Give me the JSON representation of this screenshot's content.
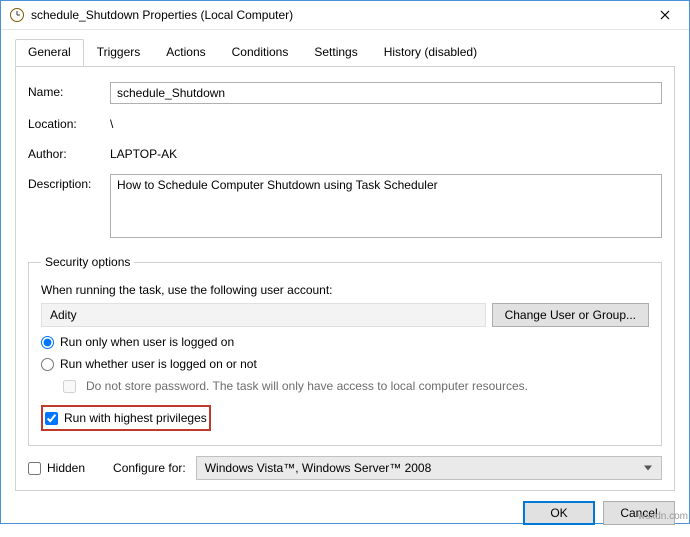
{
  "window": {
    "title": "schedule_Shutdown Properties (Local Computer)"
  },
  "tabs": {
    "general": "General",
    "triggers": "Triggers",
    "actions": "Actions",
    "conditions": "Conditions",
    "settings": "Settings",
    "history": "History (disabled)"
  },
  "labels": {
    "name": "Name:",
    "location": "Location:",
    "author": "Author:",
    "description": "Description:"
  },
  "values": {
    "name": "schedule_Shutdown",
    "location": "\\",
    "author": "LAPTOP-AK",
    "description": "How to Schedule Computer Shutdown using Task Scheduler"
  },
  "security": {
    "legend": "Security options",
    "prompt": "When running the task, use the following user account:",
    "user": "Adity",
    "change_user": "Change User or Group...",
    "run_logged_on": "Run only when user is logged on",
    "run_whether": "Run whether user is logged on or not",
    "do_not_store": "Do not store password.  The task will only have access to local computer resources.",
    "highest_priv": "Run with highest privileges"
  },
  "footer": {
    "hidden": "Hidden",
    "configure_for": "Configure for:",
    "configure_value": "Windows Vista™, Windows Server™ 2008"
  },
  "buttons": {
    "ok": "OK",
    "cancel": "Cancel"
  },
  "watermark": "wsxdn.com"
}
